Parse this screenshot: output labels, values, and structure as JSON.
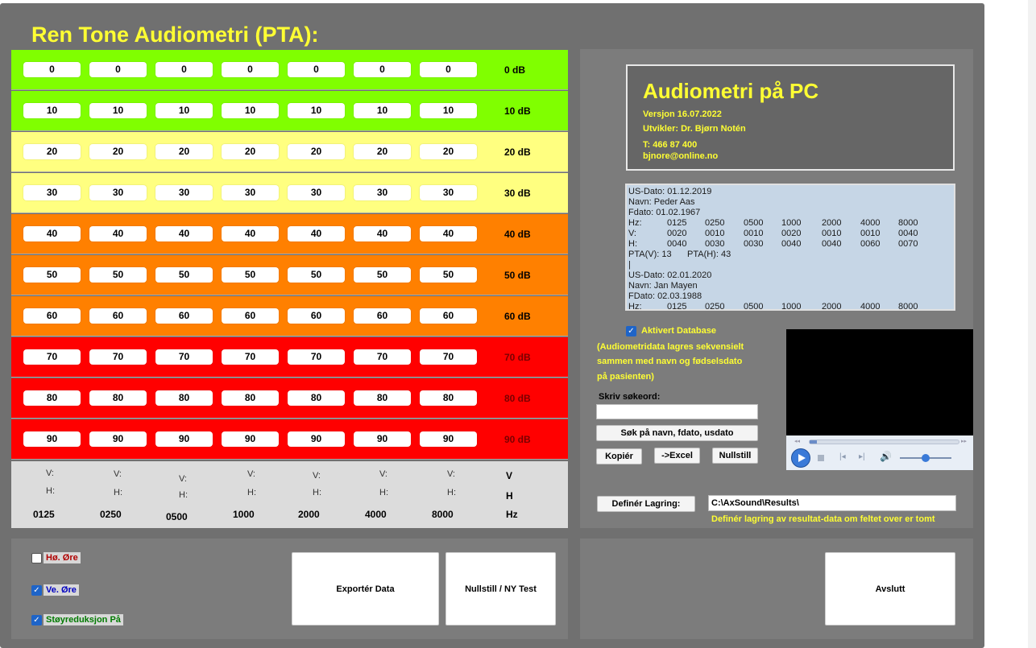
{
  "title": "Ren Tone Audiometri (PTA):",
  "bands": [
    {
      "value": "0",
      "label": "0 dB",
      "color": "#80ff00",
      "labelDark": false
    },
    {
      "value": "10",
      "label": "10 dB",
      "color": "#80ff00",
      "labelDark": false
    },
    {
      "value": "20",
      "label": "20 dB",
      "color": "#ffff80",
      "labelDark": false
    },
    {
      "value": "30",
      "label": "30 dB",
      "color": "#ffff80",
      "labelDark": false
    },
    {
      "value": "40",
      "label": "40 dB",
      "color": "#ff8000",
      "labelDark": false
    },
    {
      "value": "50",
      "label": "50 dB",
      "color": "#ff8000",
      "labelDark": false
    },
    {
      "value": "60",
      "label": "60 dB",
      "color": "#ff8000",
      "labelDark": false
    },
    {
      "value": "70",
      "label": "70 dB",
      "color": "#ff0000",
      "labelDark": true
    },
    {
      "value": "80",
      "label": "80 dB",
      "color": "#ff0000",
      "labelDark": true
    },
    {
      "value": "90",
      "label": "90 dB",
      "color": "#ff0000",
      "labelDark": true
    }
  ],
  "vh": {
    "v": "V:",
    "h": "H:",
    "v_header": "V",
    "h_header": "H",
    "hz_header": "Hz"
  },
  "frequencies": [
    "0125",
    "0250",
    "0500",
    "1000",
    "2000",
    "4000",
    "8000"
  ],
  "info": {
    "app_title": "Audiometri på PC",
    "version": "Versjon 16.07.2022",
    "developer": "Utvikler: Dr. Bjørn Notén",
    "phone": "T: 466 87 400",
    "email": "bjnore@online.no"
  },
  "database_records": [
    {
      "usdato": "US-Dato: 01.12.2019",
      "navn": "Navn: Peder Aas",
      "fdato": "Fdato: 01.02.1967",
      "hz_label": "Hz:",
      "hz": [
        "0125",
        "0250",
        "0500",
        "1000",
        "2000",
        "4000",
        "8000"
      ],
      "v_label": "V:",
      "v": [
        "0020",
        "0010",
        "0010",
        "0020",
        "0010",
        "0010",
        "0040"
      ],
      "h_label": "H:",
      "h": [
        "0040",
        "0030",
        "0030",
        "0040",
        "0040",
        "0060",
        "0070"
      ],
      "pta_v": "PTA(V): 13",
      "pta_h": "PTA(H): 43",
      "separator": "|"
    },
    {
      "usdato": "US-Dato: 02.01.2020",
      "navn": "Navn: Jan Mayen",
      "fdato": "FDato:  02.03.1988",
      "hz_label": "Hz:",
      "hz": [
        "0125",
        "0250",
        "0500",
        "1000",
        "2000",
        "4000",
        "8000"
      ]
    }
  ],
  "database": {
    "checkbox_label": "Aktivert Database",
    "checked": true,
    "note_lines": [
      "(Audiometridata lagres sekvensielt",
      "sammen med navn og fødselsdato",
      "på pasienten)"
    ],
    "search_label": "Skriv søkeord:",
    "search_value": "",
    "search_button": "Søk på navn, fdato, usdato",
    "copy_button": "Kopiér",
    "excel_button": "->Excel",
    "reset_button": "Nullstill"
  },
  "storage": {
    "button": "Definér Lagring:",
    "path": "C:\\AxSound\\Results\\",
    "hint": "Definér lagring av resultat-data om feltet over er tomt"
  },
  "options": [
    {
      "label": "Hø. Øre",
      "checked": false,
      "color": "#b00000"
    },
    {
      "label": "Ve. Øre",
      "checked": true,
      "color": "#0000c0"
    },
    {
      "label": "Støyreduksjon På",
      "checked": true,
      "color": "#007a00"
    }
  ],
  "actions": {
    "export": "Exportér Data",
    "reset_new": "Nullstill / NY Test",
    "quit": "Avslutt"
  },
  "player": {
    "progress": 0.05,
    "volume": 0.5
  }
}
